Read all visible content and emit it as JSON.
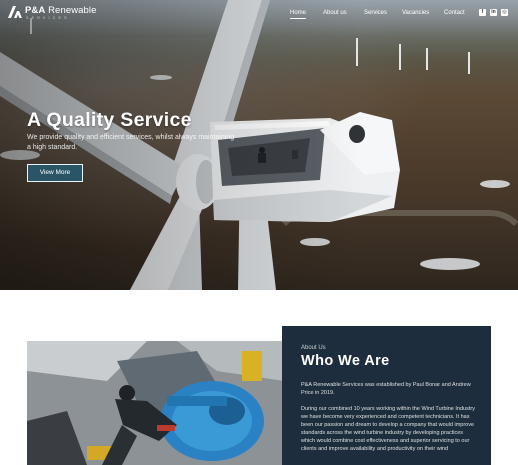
{
  "nav": {
    "logo_text_bold": "P&A",
    "logo_text_thin": " Renewable",
    "logo_sub": "SERVICES",
    "items": [
      {
        "label": "Home",
        "active": true
      },
      {
        "label": "About us",
        "active": false
      },
      {
        "label": "Services",
        "active": false
      },
      {
        "label": "Vacancies",
        "active": false
      },
      {
        "label": "Contact",
        "active": false
      }
    ],
    "social": [
      {
        "icon": "facebook-icon",
        "glyph": "f"
      },
      {
        "icon": "linkedin-icon",
        "glyph": "in"
      },
      {
        "icon": "instagram-icon",
        "glyph": "◎"
      }
    ]
  },
  "hero": {
    "title": "A Quality Service",
    "subtitle": "We provide quality and efficient services, whilst always maintaining a high standard.",
    "button_label": "View More"
  },
  "about": {
    "kicker": "About Us",
    "title": "Who We Are",
    "paragraph_1": "P&A Renewable Services was established by Paul Bonar and Andrew Price in 2019.",
    "paragraph_2": "During our combined 10 years working within the Wind Turbine Industry we have become very experienced and competent technicians. It has been our passion and dream to develop a company that would improve standards across the wind turbine industry by developing practices which would combine cost effectiveness and superior servicing to our clients and improve availability and productivity on their wind"
  },
  "colors": {
    "card_background": "#1e2d3d",
    "button_background": "#2a5566",
    "text_light": "#ffffff"
  }
}
